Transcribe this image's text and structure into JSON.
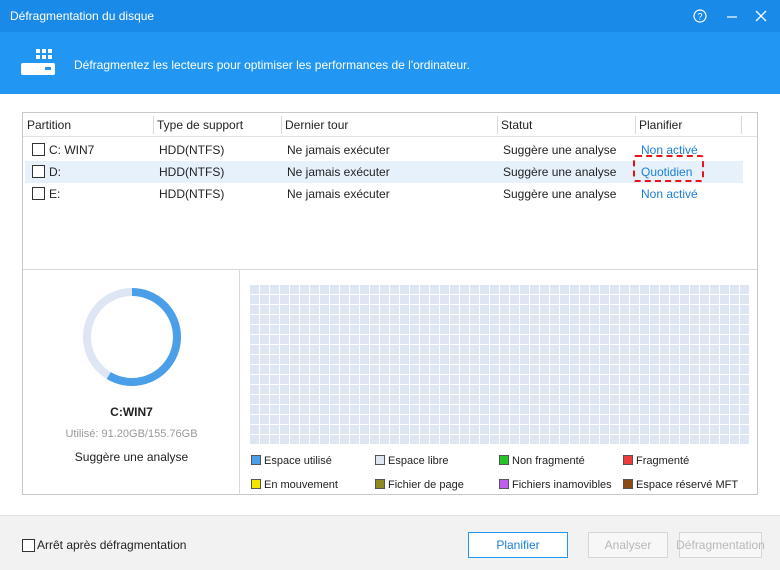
{
  "window": {
    "title": "Défragmentation du disque"
  },
  "banner": {
    "text": "Défragmentez les lecteurs pour optimiser les performances de l'ordinateur."
  },
  "table": {
    "columns": [
      "Partition",
      "Type de support",
      "Dernier tour",
      "Statut",
      "Planifier"
    ],
    "rows": [
      {
        "partition": "C:  WIN7",
        "type": "HDD(NTFS)",
        "last": "Ne jamais exécuter",
        "status": "Suggère une analyse",
        "plan": "Non activé",
        "selected": false
      },
      {
        "partition": "D:",
        "type": "HDD(NTFS)",
        "last": "Ne jamais exécuter",
        "status": "Suggère une analyse",
        "plan": "Quotidien",
        "selected": true
      },
      {
        "partition": "E:",
        "type": "HDD(NTFS)",
        "last": "Ne jamais exécuter",
        "status": "Suggère une analyse",
        "plan": "Non activé",
        "selected": false
      }
    ]
  },
  "drive": {
    "name": "C:WIN7",
    "used_text": "Utilisé: 91.20GB/155.76GB",
    "used_fraction": 0.5855,
    "status": "Suggère une analyse"
  },
  "legend": [
    {
      "label": "Espace utilisé",
      "color": "#4a9fe8"
    },
    {
      "label": "Espace libre",
      "color": "#dde6f2"
    },
    {
      "label": "Non fragmenté",
      "color": "#22c427"
    },
    {
      "label": "Fragmenté",
      "color": "#ef3b3b"
    },
    {
      "label": "En mouvement",
      "color": "#f5e600"
    },
    {
      "label": "Fichier de page",
      "color": "#8f8a1e"
    },
    {
      "label": "Fichiers inamovibles",
      "color": "#c35df0"
    },
    {
      "label": "Espace réservé MFT",
      "color": "#8a4a12"
    }
  ],
  "footer": {
    "checkbox_label": "Arrêt après défragmentation",
    "btn_schedule": "Planifier",
    "btn_analyze": "Analyser",
    "btn_defrag": "Défragmentation"
  },
  "colors": {
    "accent": "#2196f3",
    "titlebar": "#1a8ae8",
    "highlight": "#e5141b"
  }
}
